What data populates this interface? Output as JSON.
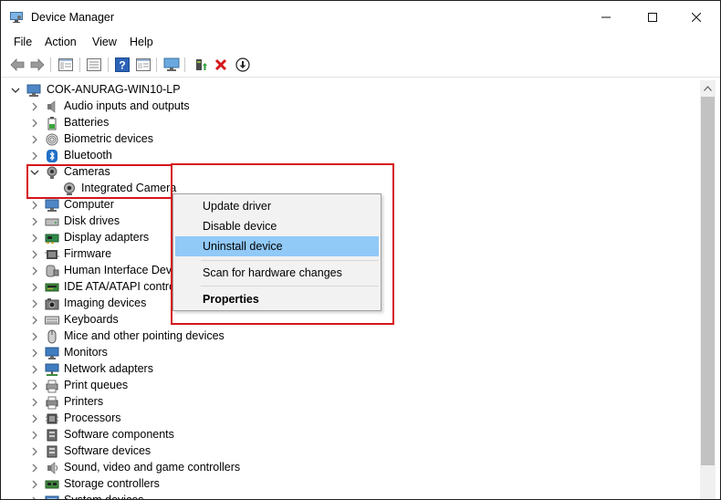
{
  "window": {
    "title": "Device Manager",
    "min_glyph": "—",
    "max_glyph": "☐",
    "close_glyph": "✕"
  },
  "menu": [
    "File",
    "Action",
    "View",
    "Help"
  ],
  "tree": {
    "root": "COK-ANURAG-WIN10-LP",
    "items": [
      {
        "label": "Audio inputs and outputs",
        "icon": "speaker-icon"
      },
      {
        "label": "Batteries",
        "icon": "battery-icon"
      },
      {
        "label": "Biometric devices",
        "icon": "fingerprint-icon"
      },
      {
        "label": "Bluetooth",
        "icon": "bluetooth-icon"
      },
      {
        "label": "Cameras",
        "icon": "camera-icon",
        "expanded": true
      },
      {
        "label": "Integrated Camera",
        "icon": "webcam-icon",
        "child": true,
        "selected": true
      },
      {
        "label": "Computer",
        "icon": "computer-icon"
      },
      {
        "label": "Disk drives",
        "icon": "disk-icon"
      },
      {
        "label": "Display adapters",
        "icon": "display-adapter-icon"
      },
      {
        "label": "Firmware",
        "icon": "firmware-icon"
      },
      {
        "label": "Human Interface Devic",
        "icon": "hid-icon"
      },
      {
        "label": "IDE ATA/ATAPI control",
        "icon": "ide-icon"
      },
      {
        "label": "Imaging devices",
        "icon": "imaging-icon"
      },
      {
        "label": "Keyboards",
        "icon": "keyboard-icon"
      },
      {
        "label": "Mice and other pointing devices",
        "icon": "mouse-icon"
      },
      {
        "label": "Monitors",
        "icon": "monitor-icon"
      },
      {
        "label": "Network adapters",
        "icon": "network-icon"
      },
      {
        "label": "Print queues",
        "icon": "print-queue-icon"
      },
      {
        "label": "Printers",
        "icon": "printer-icon"
      },
      {
        "label": "Processors",
        "icon": "processor-icon"
      },
      {
        "label": "Software components",
        "icon": "software-component-icon"
      },
      {
        "label": "Software devices",
        "icon": "software-device-icon"
      },
      {
        "label": "Sound, video and game controllers",
        "icon": "sound-icon"
      },
      {
        "label": "Storage controllers",
        "icon": "storage-icon"
      },
      {
        "label": "System devices",
        "icon": "system-icon"
      }
    ]
  },
  "context_menu": {
    "update_driver": "Update driver",
    "disable_device": "Disable device",
    "uninstall_device": "Uninstall device",
    "scan_hardware": "Scan for hardware changes",
    "properties": "Properties"
  },
  "colors": {
    "highlight": "#91c9f7",
    "annotation_red": "#d4151c",
    "remove_red": "#d4151c"
  }
}
